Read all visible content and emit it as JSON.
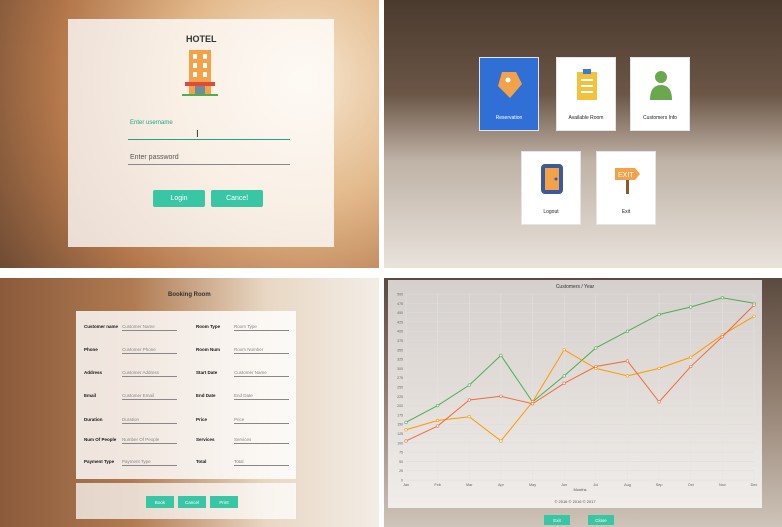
{
  "login": {
    "hotel_label": "HOTEL",
    "username_label": "Enter username",
    "password_placeholder": "Enter password",
    "login_button": "Login",
    "cancel_button": "Cancel"
  },
  "menu": {
    "tiles": [
      {
        "label": "Reservation",
        "icon": "tag-icon",
        "active": true
      },
      {
        "label": "Available Room",
        "icon": "clipboard-icon",
        "active": false
      },
      {
        "label": "Customers Info",
        "icon": "person-icon",
        "active": false
      },
      {
        "label": "Logout",
        "icon": "door-icon",
        "active": false
      },
      {
        "label": "Exit",
        "icon": "exit-sign-icon",
        "active": false
      }
    ],
    "exit_sign_text": "EXIT"
  },
  "booking": {
    "title": "Booking Room",
    "left_fields": [
      {
        "label": "Customer name",
        "placeholder": "Customer Name"
      },
      {
        "label": "Phone",
        "placeholder": "Customer Phone"
      },
      {
        "label": "Address",
        "placeholder": "Customer Address"
      },
      {
        "label": "Email",
        "placeholder": "Customer Email"
      },
      {
        "label": "Duration",
        "placeholder": "Duration"
      },
      {
        "label": "Num Of People",
        "placeholder": "Number Of People"
      },
      {
        "label": "Payment Type",
        "placeholder": "Payment Type"
      }
    ],
    "right_fields": [
      {
        "label": "Room Type",
        "placeholder": "Room Type"
      },
      {
        "label": "Room Num",
        "placeholder": "Room Number"
      },
      {
        "label": "Start Date",
        "placeholder": "Customer Name"
      },
      {
        "label": "End Date",
        "placeholder": "End Date"
      },
      {
        "label": "Price",
        "placeholder": "Price"
      },
      {
        "label": "Services",
        "placeholder": "Services"
      },
      {
        "label": "Total",
        "placeholder": "Total"
      }
    ],
    "buttons": [
      "Book",
      "Cancel",
      "Print"
    ]
  },
  "chart": {
    "footer": "© 2016 © 2016 © 2017",
    "exit_button": "Exit",
    "close_button": "Close"
  },
  "chart_data": {
    "type": "line",
    "title": "Customers / Year",
    "xlabel": "Months",
    "ylabel": "",
    "categories": [
      "Jan",
      "Feb",
      "Mar",
      "Apr",
      "May",
      "Jun",
      "Jul",
      "Aug",
      "Sep",
      "Oct",
      "Nov",
      "Dec"
    ],
    "ylim": [
      0,
      500
    ],
    "yticks": [
      0,
      25,
      50,
      75,
      100,
      125,
      150,
      175,
      200,
      225,
      250,
      275,
      300,
      325,
      350,
      375,
      400,
      425,
      450,
      475,
      500
    ],
    "series": [
      {
        "color": "#4caf50",
        "values": [
          155,
          200,
          255,
          335,
          210,
          280,
          355,
          400,
          445,
          465,
          490,
          475
        ]
      },
      {
        "color": "#ff9800",
        "values": [
          135,
          160,
          170,
          105,
          210,
          350,
          300,
          280,
          300,
          330,
          390,
          440
        ]
      },
      {
        "color": "#ef6c3a",
        "values": [
          105,
          145,
          215,
          225,
          205,
          260,
          305,
          320,
          210,
          305,
          385,
          470
        ]
      }
    ],
    "grid": true
  }
}
